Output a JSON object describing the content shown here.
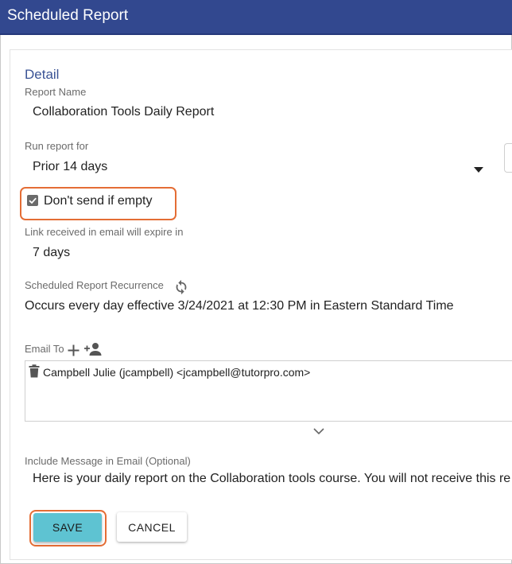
{
  "window": {
    "title": "Scheduled Report"
  },
  "detail": {
    "section_title": "Detail",
    "report_name": {
      "label": "Report Name",
      "value": "Collaboration Tools Daily Report"
    },
    "run_report_for": {
      "label": "Run report for",
      "value": "Prior 14 days"
    },
    "dont_send_if_empty": {
      "label": "Don't send if empty",
      "checked": true
    },
    "link_expire": {
      "label": "Link received in email will expire in",
      "value": "7 days"
    },
    "recurrence": {
      "label": "Scheduled Report Recurrence",
      "value": "Occurs every day effective 3/24/2021 at 12:30 PM in Eastern Standard Time"
    },
    "email_to": {
      "label": "Email To",
      "recipients": [
        {
          "text": "Campbell Julie (jcampbell) <jcampbell@tutorpro.com>"
        }
      ]
    },
    "message": {
      "label": "Include Message in Email (Optional)",
      "value": "Here is your daily report on the Collaboration tools course.  You will not receive this re"
    }
  },
  "actions": {
    "save_label": "SAVE",
    "cancel_label": "CANCEL"
  },
  "colors": {
    "title_bar": "#32488f",
    "accent": "#3a5395",
    "highlight": "#e46d35",
    "save": "#5ec3d2"
  },
  "icons": [
    "refresh-icon",
    "plus-icon",
    "add-person-icon",
    "trash-icon",
    "chevron-down-icon",
    "dropdown-arrow-icon"
  ]
}
